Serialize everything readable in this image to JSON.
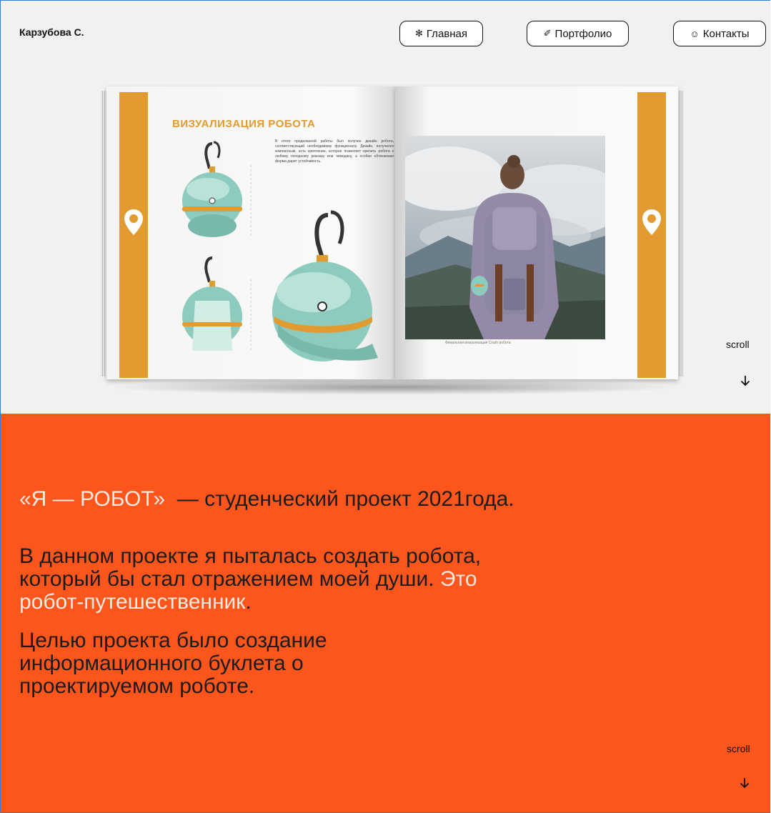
{
  "header": {
    "brand": "Карзубова С.",
    "nav": [
      {
        "icon": "snowflake-icon",
        "glyph": "✻",
        "label": "Главная"
      },
      {
        "icon": "pen-icon",
        "glyph": "✐",
        "label": "Портфолио"
      },
      {
        "icon": "smiley-icon",
        "glyph": "☺",
        "label": "Контакты"
      }
    ]
  },
  "hero": {
    "booklet_title": "ВИЗУАЛИЗАЦИЯ РОБОТА",
    "booklet_text": "В итоге проделанной работы был получен дизайн робота, соответствующий необходимому функционалу. Дизайн, получился компактным, есть крепление, которое позволяет крепить робота к любому походному рюкзаку или чемодану, а особая обтекаемая форма дарит устойчивость.",
    "booklet_caption": "Финальная визуализация Crash робота",
    "scroll_label": "scroll"
  },
  "about": {
    "p1_highlight": "«Я — РОБОТ»",
    "p1_rest": "  — студенческий проект 2021года.",
    "p2_start": "В данном проекте я пыталась создать робота, который бы стал отражением моей души. ",
    "p2_highlight": "Это робот-путешественник",
    "p2_end": ".",
    "p3": "Целью проекта было создание информационного буклета о проектируемом роботе.",
    "scroll_label": "scroll"
  },
  "colors": {
    "accent_orange": "#fd561d",
    "booklet_gold": "#e19b31",
    "robot_teal": "#8ccbbd",
    "highlight_text": "#fde9df"
  }
}
